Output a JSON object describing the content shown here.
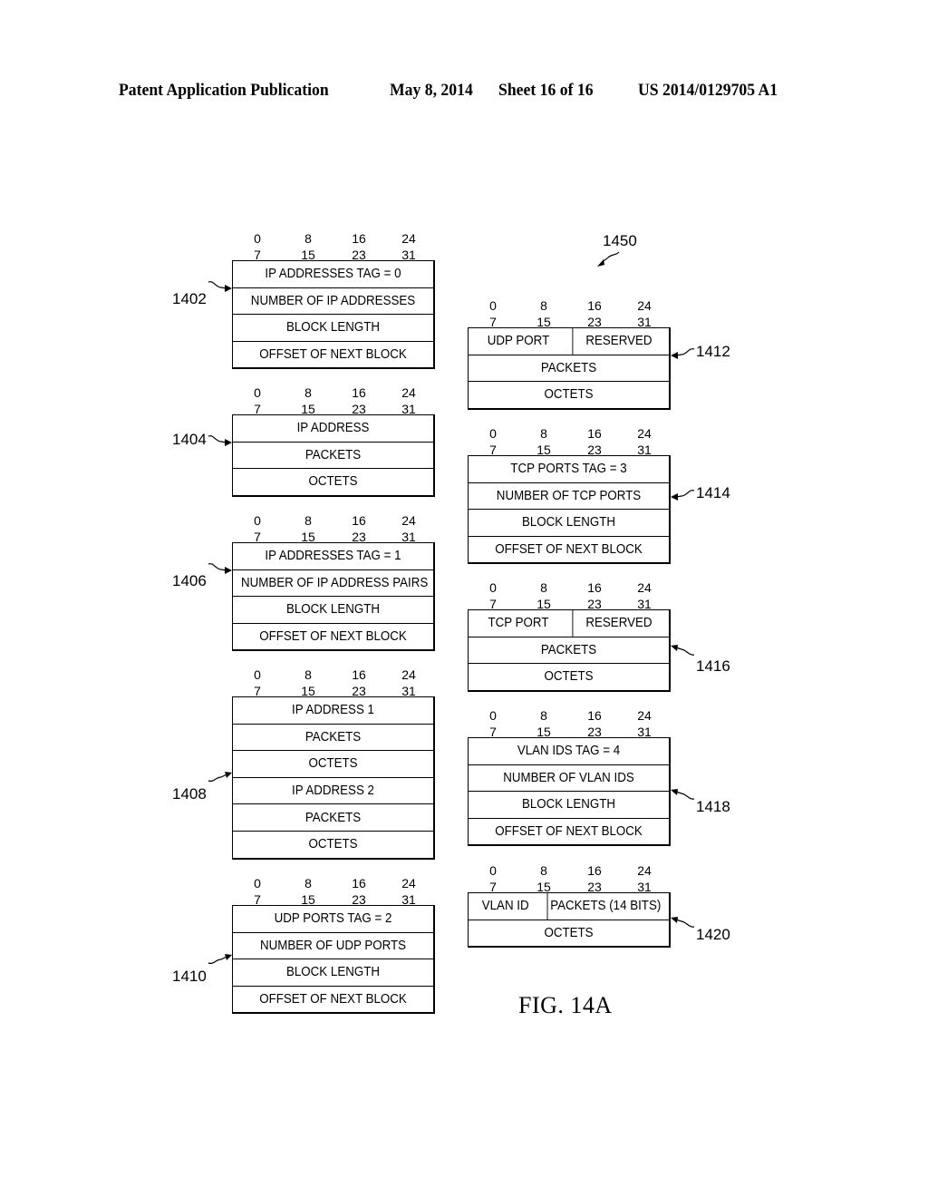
{
  "header": {
    "publication": "Patent Application Publication",
    "date": "May 8, 2014",
    "sheet": "Sheet 16 of 16",
    "number": "US 2014/0129705 A1"
  },
  "bit_labels": {
    "top": [
      "0",
      "8",
      "16",
      "24"
    ],
    "bottom": [
      "7",
      "15",
      "23",
      "31"
    ]
  },
  "figure": {
    "label": "FIG. 14A",
    "ref": "1450"
  },
  "blocks": {
    "b1402": {
      "ref": "1402",
      "rows": [
        [
          "IP ADDRESSES TAG = 0"
        ],
        [
          "NUMBER OF IP ADDRESSES"
        ],
        [
          "BLOCK LENGTH"
        ],
        [
          "OFFSET OF NEXT BLOCK"
        ]
      ]
    },
    "b1404": {
      "ref": "1404",
      "rows": [
        [
          "IP ADDRESS"
        ],
        [
          "PACKETS"
        ],
        [
          "OCTETS"
        ]
      ]
    },
    "b1406": {
      "ref": "1406",
      "rows": [
        [
          "IP ADDRESSES TAG = 1"
        ],
        [
          "NUMBER OF IP ADDRESS PAIRS"
        ],
        [
          "BLOCK LENGTH"
        ],
        [
          "OFFSET OF NEXT BLOCK"
        ]
      ]
    },
    "b1408": {
      "ref": "1408",
      "rows": [
        [
          "IP ADDRESS 1"
        ],
        [
          "PACKETS"
        ],
        [
          "OCTETS"
        ],
        [
          "IP ADDRESS 2"
        ],
        [
          "PACKETS"
        ],
        [
          "OCTETS"
        ]
      ]
    },
    "b1410": {
      "ref": "1410",
      "rows": [
        [
          "UDP PORTS TAG = 2"
        ],
        [
          "NUMBER OF UDP PORTS"
        ],
        [
          "BLOCK LENGTH"
        ],
        [
          "OFFSET OF NEXT BLOCK"
        ]
      ]
    },
    "b1412": {
      "ref": "1412",
      "rows": [
        [
          "UDP PORT",
          "RESERVED"
        ],
        [
          "PACKETS"
        ],
        [
          "OCTETS"
        ]
      ]
    },
    "b1414": {
      "ref": "1414",
      "rows": [
        [
          "TCP PORTS TAG = 3"
        ],
        [
          "NUMBER OF TCP PORTS"
        ],
        [
          "BLOCK LENGTH"
        ],
        [
          "OFFSET OF NEXT BLOCK"
        ]
      ]
    },
    "b1416": {
      "ref": "1416",
      "rows": [
        [
          "TCP PORT",
          "RESERVED"
        ],
        [
          "PACKETS"
        ],
        [
          "OCTETS"
        ]
      ]
    },
    "b1418": {
      "ref": "1418",
      "rows": [
        [
          "VLAN IDS TAG = 4"
        ],
        [
          "NUMBER OF VLAN IDS"
        ],
        [
          "BLOCK LENGTH"
        ],
        [
          "OFFSET OF NEXT BLOCK"
        ]
      ]
    },
    "b1420": {
      "ref": "1420",
      "rows": [
        [
          "VLAN ID",
          "PACKETS (14 BITS)"
        ],
        [
          "OCTETS"
        ]
      ]
    }
  }
}
